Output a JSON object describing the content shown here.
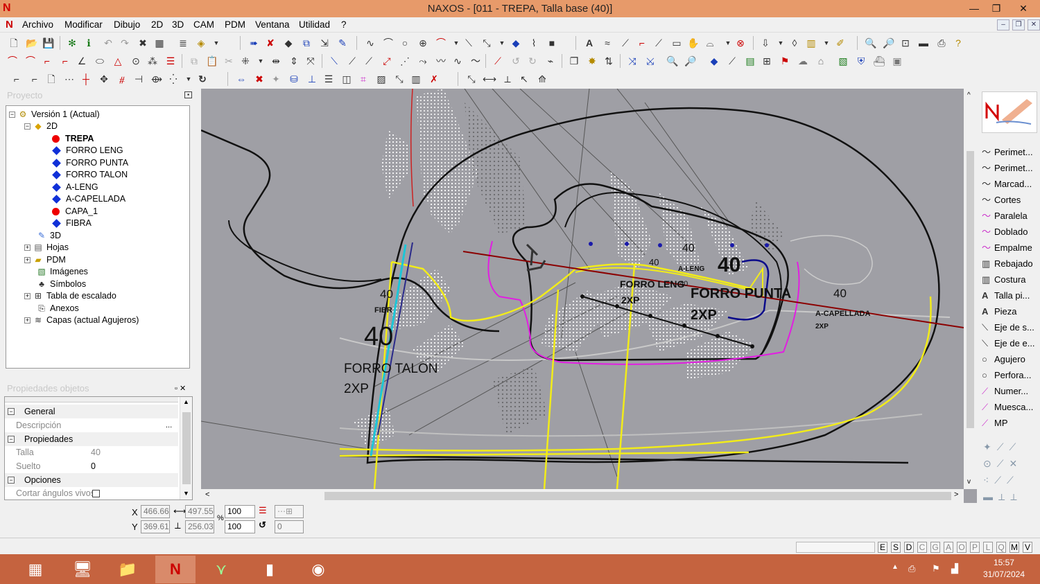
{
  "window": {
    "title": "NAXOS - [011 - TREPA, Talla base (40)]",
    "minimize": "—",
    "restore": "❐",
    "close": "✕"
  },
  "menu": [
    "Archivo",
    "Modificar",
    "Dibujo",
    "2D",
    "3D",
    "CAM",
    "PDM",
    "Ventana",
    "Utilidad",
    "?"
  ],
  "project": {
    "header": "Proyecto",
    "tree": [
      {
        "label": "Versión 1 (Actual)",
        "level": 0,
        "expand": "−",
        "icon": "version"
      },
      {
        "label": "2D",
        "level": 1,
        "expand": "−",
        "icon": "2d"
      },
      {
        "label": "TREPA",
        "level": 2,
        "icon": "red-dot",
        "bold": true
      },
      {
        "label": "FORRO LENG",
        "level": 2,
        "icon": "blue-diamond"
      },
      {
        "label": "FORRO PUNTA",
        "level": 2,
        "icon": "blue-diamond"
      },
      {
        "label": "FORRO TALON",
        "level": 2,
        "icon": "blue-diamond"
      },
      {
        "label": "A-LENG",
        "level": 2,
        "icon": "blue-diamond"
      },
      {
        "label": "A-CAPELLADA",
        "level": 2,
        "icon": "blue-diamond"
      },
      {
        "label": "CAPA_1",
        "level": 2,
        "icon": "red-dot"
      },
      {
        "label": "FIBRA",
        "level": 2,
        "icon": "blue-diamond"
      },
      {
        "label": "3D",
        "level": 1,
        "icon": "3d"
      },
      {
        "label": "Hojas",
        "level": 1,
        "expand": "+",
        "icon": "sheets"
      },
      {
        "label": "PDM",
        "level": 1,
        "expand": "+",
        "icon": "pdm"
      },
      {
        "label": "Imágenes",
        "level": 1,
        "icon": "images"
      },
      {
        "label": "Símbolos",
        "level": 1,
        "icon": "symbols"
      },
      {
        "label": "Tabla de escalado",
        "level": 1,
        "expand": "+",
        "icon": "table"
      },
      {
        "label": "Anexos",
        "level": 1,
        "icon": "clip"
      },
      {
        "label": "Capas (actual Agujeros)",
        "level": 1,
        "expand": "+",
        "icon": "layers"
      }
    ]
  },
  "properties": {
    "header": "Propiedades objetos",
    "rows": [
      {
        "type": "section",
        "label": "General"
      },
      {
        "type": "row",
        "key": "Descripción",
        "value": "",
        "btn": "..."
      },
      {
        "type": "section",
        "label": "Propiedades"
      },
      {
        "type": "row",
        "key": "Talla",
        "value": "40"
      },
      {
        "type": "row",
        "key": "Suelto",
        "value": "0"
      },
      {
        "type": "section",
        "label": "Opciones"
      },
      {
        "type": "row",
        "key": "Cortar ángulos vivos",
        "value": "",
        "check": true
      }
    ]
  },
  "canvas": {
    "labels": {
      "t40a": "40",
      "t40b": "40",
      "t40big": "40",
      "t40c": "40",
      "t40d": "40",
      "t40e": "40",
      "t40heel": "40",
      "forro_punta": "FORRO PUNTA",
      "forro_leng": "FORRO LENG",
      "forro_talon": "FORRO TALON",
      "xp1": "2XP",
      "xp2": "2XP",
      "xp3": "2XP",
      "xp4": "2XP",
      "aleng": "A-LENG",
      "acap": "A-CAPELLADA",
      "fibr": "FIBR"
    }
  },
  "right_tools": [
    {
      "label": "Perimet...",
      "icon": "〜"
    },
    {
      "label": "Perimet...",
      "icon": "〜"
    },
    {
      "label": "Marcad...",
      "icon": "〜"
    },
    {
      "label": "Cortes",
      "icon": "〜"
    },
    {
      "label": "Paralela",
      "icon": "〜"
    },
    {
      "label": "Doblado",
      "icon": "〜"
    },
    {
      "label": "Empalme",
      "icon": "〜"
    },
    {
      "label": "Rebajado",
      "icon": "▥"
    },
    {
      "label": "Costura",
      "icon": "▥"
    },
    {
      "label": "Talla pi...",
      "icon": "A"
    },
    {
      "label": "Pieza",
      "icon": "A"
    },
    {
      "label": "Eje de s...",
      "icon": "⟍"
    },
    {
      "label": "Eje de e...",
      "icon": "⟍"
    },
    {
      "label": "Agujero",
      "icon": "○"
    },
    {
      "label": "Perfora...",
      "icon": "○"
    },
    {
      "label": "Numer...",
      "icon": "⟋"
    },
    {
      "label": "Muesca...",
      "icon": "⟋"
    },
    {
      "label": "MP",
      "icon": "⟋"
    }
  ],
  "coords": {
    "x_label": "X",
    "y_label": "Y",
    "x": "466.66",
    "y": "369.61",
    "w": "497.55",
    "h": "256.03",
    "pct_sym": "%",
    "sx": "100",
    "sy": "100",
    "rot": "0"
  },
  "status_letters": [
    "E",
    "S",
    "D",
    "C",
    "G",
    "A",
    "O",
    "P",
    "L",
    "Q",
    "M",
    "V"
  ],
  "status_on": [
    "E",
    "S",
    "D",
    "M",
    "V"
  ],
  "clock": {
    "time": "15:57",
    "date": "31/07/2024"
  },
  "colors": {
    "titlebar": "#e79a6a",
    "taskbar": "#c5633f",
    "canvas": "#9f9fa5",
    "magenta": "#e21ee2",
    "yellow": "#f2ec19",
    "darkred": "#8b0000",
    "cyan": "#1cc6d8",
    "navy": "#0a0a8a"
  }
}
